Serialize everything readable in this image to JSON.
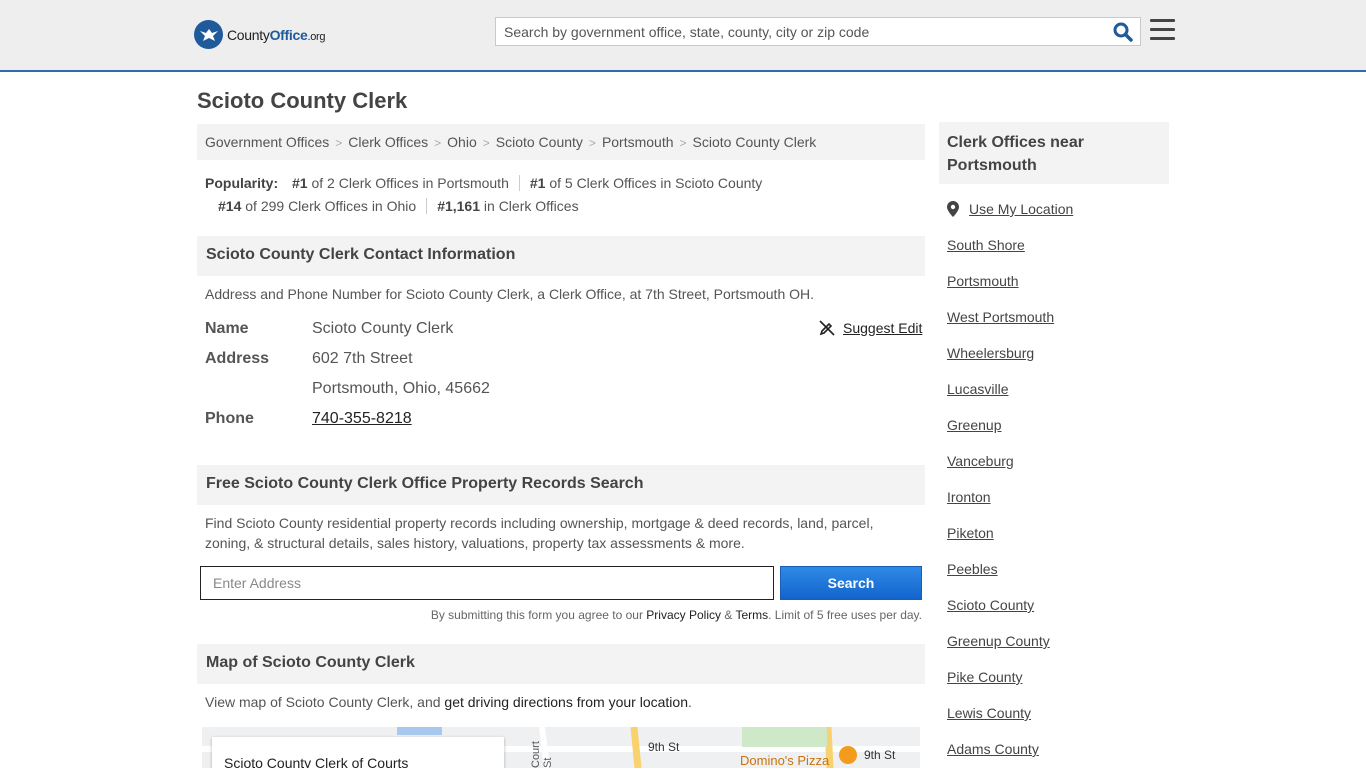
{
  "header": {
    "logo_county": "County",
    "logo_office": "Office",
    "logo_org": ".org",
    "search_placeholder": "Search by government office, state, county, city or zip code"
  },
  "page_title": "Scioto County Clerk",
  "breadcrumb": [
    "Government Offices",
    "Clerk Offices",
    "Ohio",
    "Scioto County",
    "Portsmouth",
    "Scioto County Clerk"
  ],
  "popularity": {
    "label": "Popularity:",
    "items": [
      {
        "rank": "#1",
        "text": "of 2 Clerk Offices in Portsmouth"
      },
      {
        "rank": "#1",
        "text": "of 5 Clerk Offices in Scioto County"
      },
      {
        "rank": "#14",
        "text": "of 299 Clerk Offices in Ohio"
      },
      {
        "rank": "#1,161",
        "text": "in Clerk Offices"
      }
    ]
  },
  "contact": {
    "heading": "Scioto County Clerk Contact Information",
    "description": "Address and Phone Number for Scioto County Clerk, a Clerk Office, at 7th Street, Portsmouth OH.",
    "name_label": "Name",
    "name_value": "Scioto County Clerk",
    "address_label": "Address",
    "address_line1": "602 7th Street",
    "address_line2": "Portsmouth, Ohio, 45662",
    "phone_label": "Phone",
    "phone_value": "740-355-8218",
    "suggest_edit": "Suggest Edit"
  },
  "property": {
    "heading": "Free Scioto County Clerk Office Property Records Search",
    "description_line1": "Find Scioto County residential property records including ownership, mortgage & deed records, land, parcel,",
    "description_line2": "zoning, & structural details, sales history, valuations, property tax assessments & more.",
    "input_placeholder": "Enter Address",
    "search_label": "Search",
    "disclaimer_pre": "By submitting this form you agree to our",
    "privacy_link": "Privacy Policy",
    "amp": "&",
    "terms_link": "Terms",
    "disclaimer_post": ". Limit of 5 free uses per day."
  },
  "map_section": {
    "heading": "Map of Scioto County Clerk",
    "description_pre": "View map of Scioto County Clerk, and",
    "directions_link": "get driving directions from your location",
    "description_post": ".",
    "card_title": "Scioto County Clerk of Courts",
    "street_9th": "9th St",
    "street_9th_2": "9th St",
    "street_court": "Court St",
    "poi_dominos": "Domino's Pizza"
  },
  "sidebar": {
    "heading": "Clerk Offices near Portsmouth",
    "use_location": "Use My Location",
    "links": [
      "South Shore",
      "Portsmouth",
      "West Portsmouth",
      "Wheelersburg",
      "Lucasville",
      "Greenup",
      "Vanceburg",
      "Ironton",
      "Piketon",
      "Peebles",
      "Scioto County",
      "Greenup County",
      "Pike County",
      "Lewis County",
      "Adams County"
    ]
  },
  "colors": {
    "brand_blue": "#1f5a9a",
    "header_border": "#2c6cb1",
    "button_blue": "#1a6fd6"
  }
}
